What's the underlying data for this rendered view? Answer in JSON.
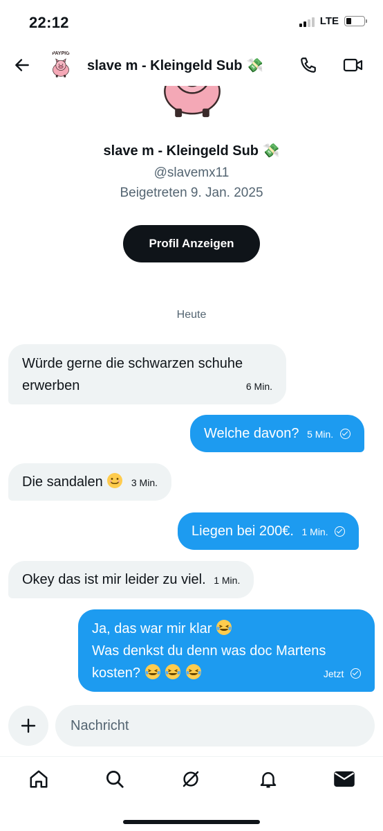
{
  "status": {
    "time": "22:12",
    "network": "LTE"
  },
  "header": {
    "title": "slave m - Kleingeld Sub 💸",
    "avatar_text": "PAYPIG"
  },
  "profile": {
    "name": "slave m - Kleingeld Sub 💸",
    "handle": "@slavemx11",
    "joined": "Beigetreten 9. Jan. 2025",
    "button_label": "Profil Anzeigen"
  },
  "day_label": "Heute",
  "messages": [
    {
      "direction": "in",
      "text_line1": "Würde gerne die schwarzen schuhe",
      "text_line2": "erwerben",
      "time": "6 Min."
    },
    {
      "direction": "out",
      "text": "Welche davon?",
      "time": "5 Min."
    },
    {
      "direction": "in",
      "text": "Die sandalen",
      "time": "3 Min."
    },
    {
      "direction": "out",
      "text": "Liegen bei 200€.",
      "time": "1 Min."
    },
    {
      "direction": "in",
      "text": "Okey das ist mir leider zu viel.",
      "time": "1 Min."
    },
    {
      "direction": "out",
      "text_line1": "Ja, das war mir klar",
      "text_line2": "Was denkst du denn was doc Martens",
      "text_line3": "kosten?",
      "time": "Jetzt"
    }
  ],
  "composer": {
    "placeholder": "Nachricht"
  },
  "tabs": [
    "home-icon",
    "search-icon",
    "grok-icon",
    "notifications-icon",
    "messages-icon"
  ],
  "colors": {
    "accent": "#1d9bf0",
    "incoming_bubble": "#eff3f4",
    "text": "#0f1419",
    "secondary_text": "#536471"
  }
}
